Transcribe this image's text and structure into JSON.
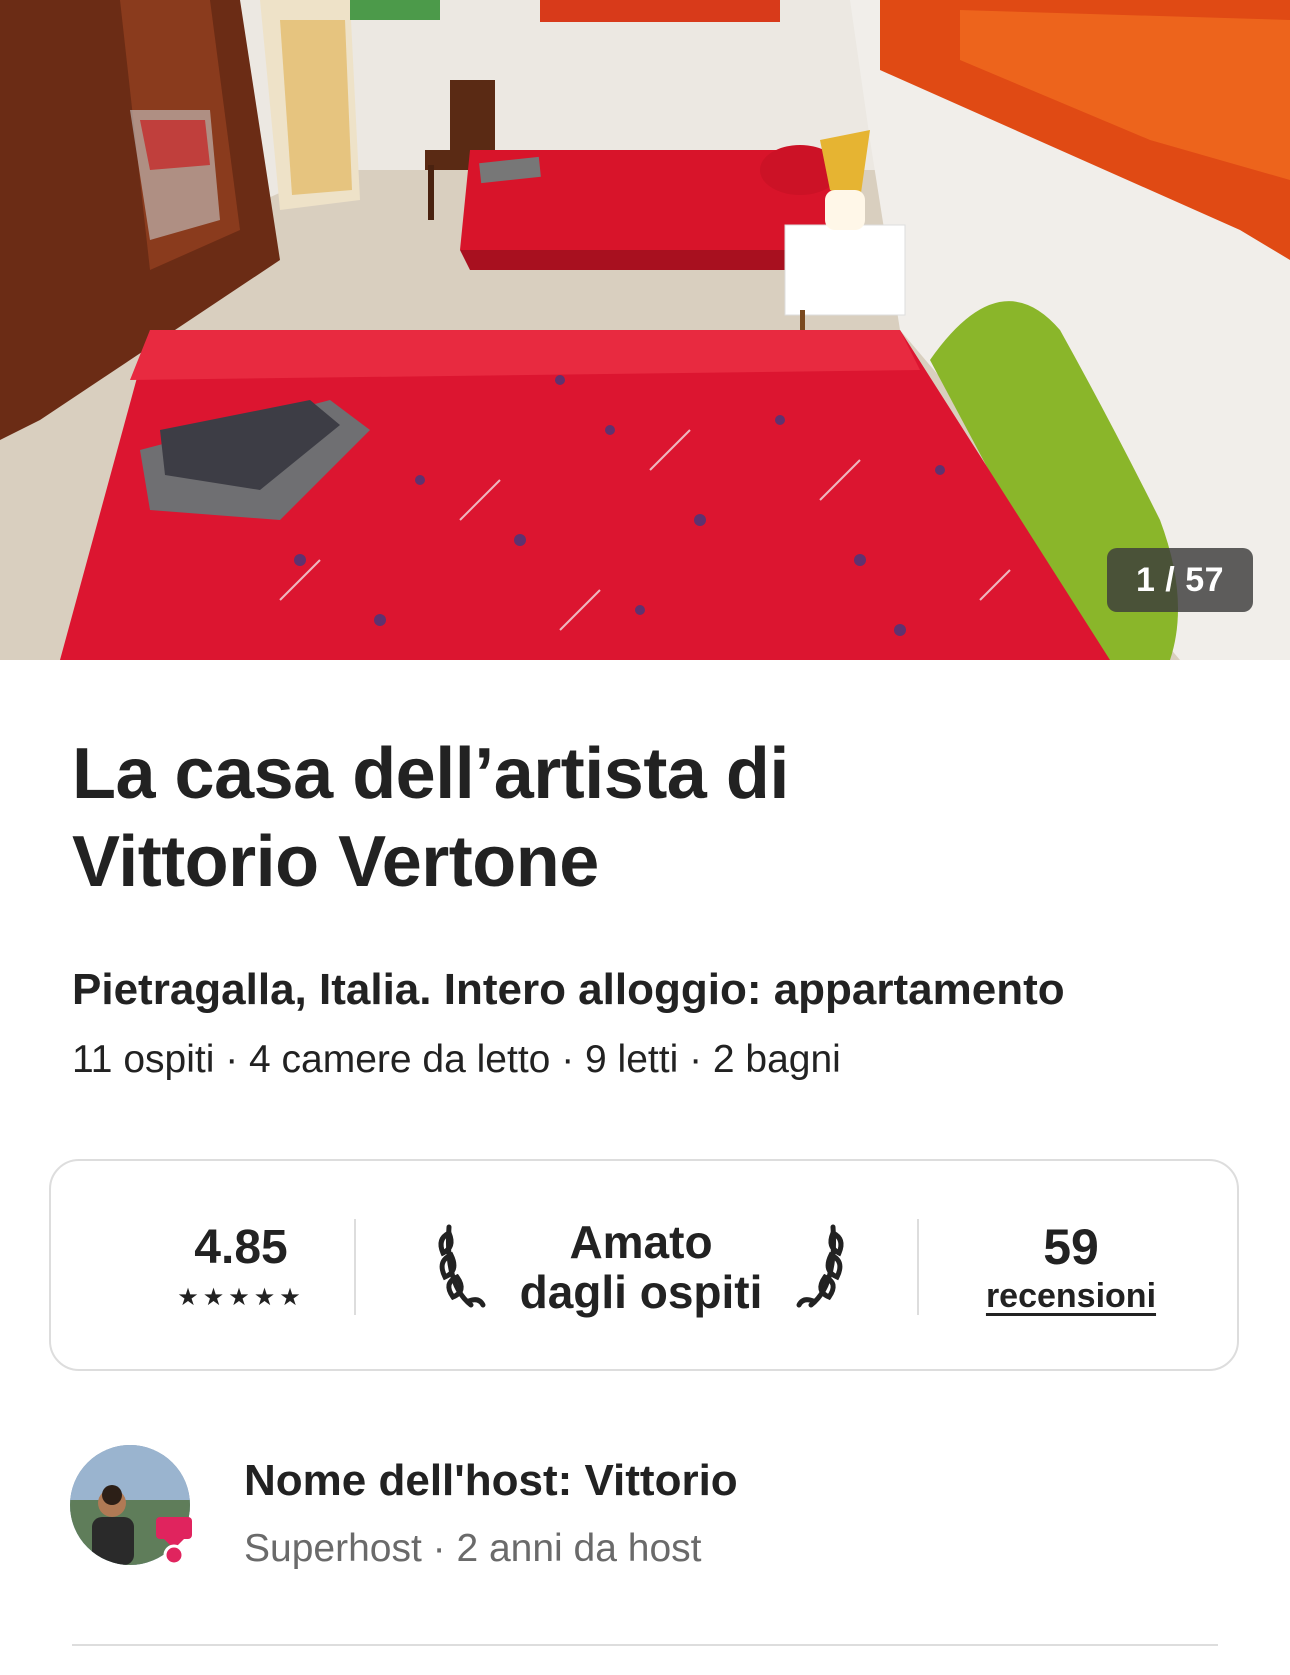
{
  "photo": {
    "counter": "1 / 57"
  },
  "listing": {
    "title_line1": "La casa dell’artista di",
    "title_line2": "Vittorio Vertone",
    "subtitle": "Pietragalla, Italia. Intero alloggio: appartamento",
    "details": "11 ospiti · 4 camere da letto · 9 letti · 2 bagni"
  },
  "rating": {
    "score": "4.85",
    "stars": "★★★★★",
    "badge_line1": "Amato",
    "badge_line2": "dagli ospiti",
    "reviews_count": "59",
    "reviews_label": "recensioni"
  },
  "host": {
    "name": "Nome dell'host: Vittorio",
    "meta": "Superhost · 2 anni da host"
  },
  "colors": {
    "text": "#222222",
    "muted": "#6a6a6a",
    "border": "#dddddd",
    "accent": "#e0245e"
  },
  "icons": {
    "laurel_left": "laurel-left-icon",
    "laurel_right": "laurel-right-icon",
    "superhost": "superhost-badge-icon"
  }
}
